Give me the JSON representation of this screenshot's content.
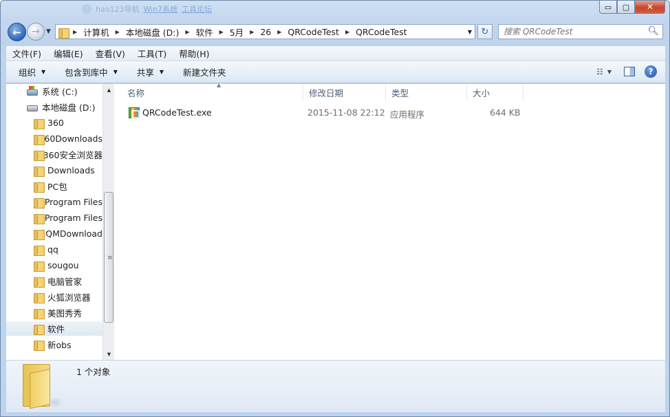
{
  "window": {
    "title_blur": [
      "hao123导航",
      "Win7系统",
      "工具论坛"
    ],
    "caption": {
      "minimize": "▭",
      "maximize": "▢",
      "close": "✕"
    }
  },
  "nav": {
    "back": "←",
    "forward": "→",
    "address": {
      "crumbs": [
        "计算机",
        "本地磁盘 (D:)",
        "软件",
        "5月",
        "26",
        "QRCodeTest",
        "QRCodeTest"
      ],
      "separator": "▶"
    },
    "refresh": "↻",
    "search_placeholder": "搜索 QRCodeTest",
    "search_icon": "magnifier"
  },
  "menubar": {
    "items": [
      "文件(F)",
      "编辑(E)",
      "查看(V)",
      "工具(T)",
      "帮助(H)"
    ]
  },
  "toolbar": {
    "organize": "组织",
    "include_library": "包含到库中",
    "share": "共享",
    "new_folder": "新建文件夹"
  },
  "sidebar": {
    "items": [
      {
        "label": "系统 (C:)",
        "icon": "drive-c-icon"
      },
      {
        "label": "本地磁盘 (D:)",
        "icon": "drive-icon"
      },
      {
        "label": "360",
        "icon": "folder-icon"
      },
      {
        "label": "360Downloads",
        "icon": "folder-icon"
      },
      {
        "label": "360安全浏览器",
        "icon": "folder-icon"
      },
      {
        "label": "Downloads",
        "icon": "folder-icon"
      },
      {
        "label": "PC包",
        "icon": "folder-icon"
      },
      {
        "label": "Program Files",
        "icon": "folder-icon"
      },
      {
        "label": "Program Files",
        "icon": "folder-icon"
      },
      {
        "label": "QMDownload",
        "icon": "folder-icon"
      },
      {
        "label": "qq",
        "icon": "folder-icon"
      },
      {
        "label": "sougou",
        "icon": "folder-icon"
      },
      {
        "label": "电脑管家",
        "icon": "folder-icon"
      },
      {
        "label": "火狐浏览器",
        "icon": "folder-icon"
      },
      {
        "label": "美图秀秀",
        "icon": "folder-icon"
      },
      {
        "label": "软件",
        "icon": "folder-icon",
        "selected": true
      },
      {
        "label": "新obs",
        "icon": "folder-icon"
      }
    ]
  },
  "columns": {
    "name": "名称",
    "modified": "修改日期",
    "type": "类型",
    "size": "大小"
  },
  "files": [
    {
      "name": "QRCodeTest.exe",
      "modified": "2015-11-08 22:12",
      "type": "应用程序",
      "size": "644 KB"
    }
  ],
  "details": {
    "count": "1 个对象"
  },
  "colors": {
    "accent": "#2c66b8",
    "chrome": "#c3d6ee",
    "selection": "#dfe8f2"
  }
}
